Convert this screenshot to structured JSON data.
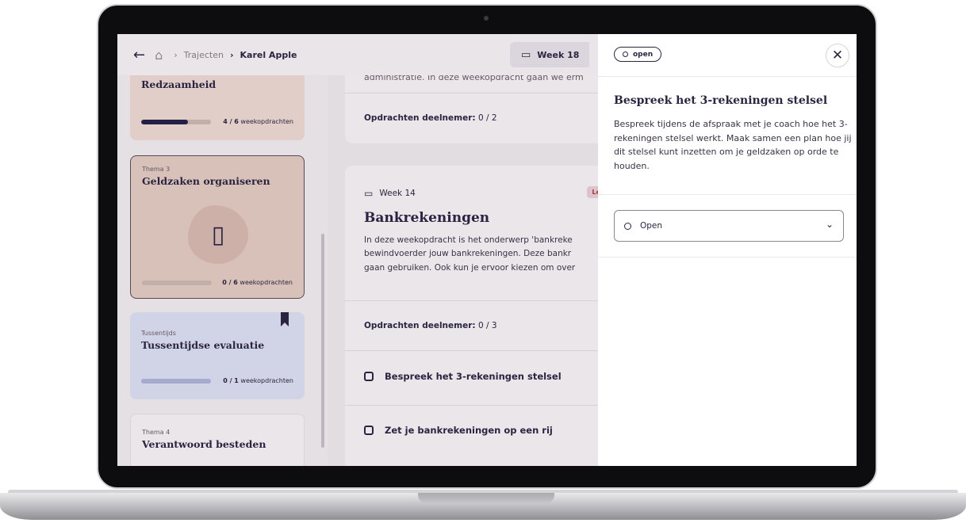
{
  "topbar": {
    "breadcrumb_section": "Trajecten",
    "breadcrumb_current": "Karel Apple",
    "week_label": "Week 18"
  },
  "sidebar": {
    "cards": [
      {
        "thema": "",
        "title": "Redzaamheid",
        "progress_count": "4 / 6",
        "progress_unit": "weekopdrachten",
        "progress_fraction": 0.67,
        "style": "peach"
      },
      {
        "thema": "Thema 3",
        "title": "Geldzaken organiseren",
        "progress_count": "0 / 6",
        "progress_unit": "weekopdrachten",
        "progress_fraction": 0.0,
        "style": "selected"
      },
      {
        "thema": "Tussentijds",
        "title": "Tussentijdse evaluatie",
        "progress_count": "0 / 1",
        "progress_unit": "weekopdrachten",
        "progress_fraction": 0.0,
        "style": "blue"
      },
      {
        "thema": "Thema 4",
        "title": "Verantwoord besteden",
        "style": "light"
      }
    ]
  },
  "content": {
    "panel1": {
      "partial_text": "administratie. In deze weekopdracht gaan we erm",
      "assignments_label": "Opdrachten deelnemer:",
      "assignments_value": "0 / 2"
    },
    "panel2": {
      "week": "Week 14",
      "badge": "Let o",
      "title": "Bankrekeningen",
      "body_lines": [
        "In deze weekopdracht is het onderwerp 'bankreke",
        "bewindvoerder jouw bankrekeningen. Deze bankr",
        "gaan gebruiken. Ook kun je ervoor kiezen om over"
      ],
      "assignments_label": "Opdrachten deelnemer:",
      "assignments_value": "0 / 3",
      "tasks": [
        "Bespreek het 3-rekeningen stelsel",
        "Zet je bankrekeningen op een rij"
      ]
    }
  },
  "drawer": {
    "status_pill": "open",
    "title": "Bespreek het 3-rekeningen stelsel",
    "description": "Bespreek tijdens de afspraak met je coach hoe het 3-rekeningen stelsel werkt. Maak samen een plan hoe jij dit stelsel kunt inzetten om je geldzaken op orde te houden.",
    "select_value": "Open"
  },
  "colors": {
    "ink": "#2b2540",
    "progress_fill": "#232046",
    "card_peach": "#eed9d1",
    "card_selected": "#e4cbc0",
    "card_blue": "#dcdff0",
    "warning": "#b33b47"
  },
  "icons": [
    "back-arrow-icon",
    "home-icon",
    "chevron-right-icon",
    "calendar-icon",
    "bookmark-icon",
    "phone-card-illustration-icon",
    "checkbox-icon",
    "close-icon",
    "status-circle-icon",
    "chevron-down-icon"
  ]
}
